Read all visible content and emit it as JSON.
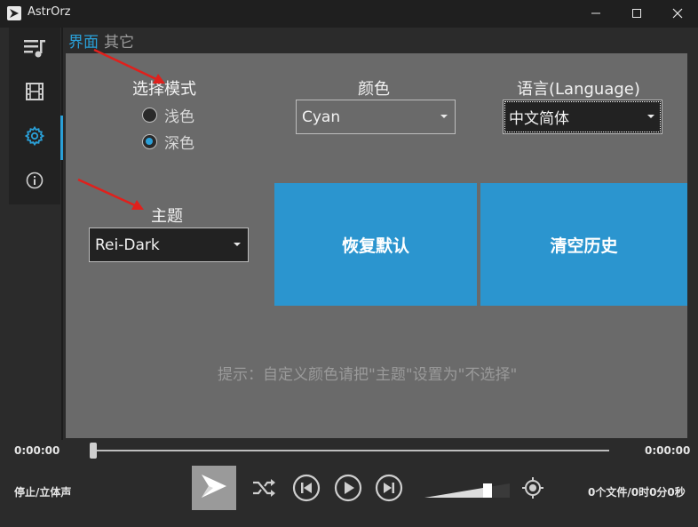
{
  "window": {
    "title": "AstrOrz",
    "minimize_icon": "minimize-icon",
    "maximize_icon": "maximize-icon",
    "close_icon": "close-icon"
  },
  "sidebar": {
    "items": [
      {
        "icon": "playlist-icon"
      },
      {
        "icon": "film-icon"
      },
      {
        "icon": "gear-icon",
        "active": true
      },
      {
        "icon": "info-icon"
      }
    ]
  },
  "tabs": [
    {
      "label": "界面",
      "active": true
    },
    {
      "label": "其它",
      "active": false
    }
  ],
  "settings": {
    "mode_label": "选择模式",
    "mode_options": [
      {
        "label": "浅色",
        "checked": false
      },
      {
        "label": "深色",
        "checked": true
      }
    ],
    "color_label": "颜色",
    "color_value": "Cyan",
    "language_label": "语言(Language)",
    "language_value": "中文简体",
    "theme_label": "主题",
    "theme_value": "Rei-Dark",
    "reset_button": "恢复默认",
    "clear_history_button": "清空历史",
    "hint": "提示：自定义颜色请把\"主题\"设置为\"不选择\""
  },
  "player": {
    "current_time": "0:00:00",
    "total_time": "0:00:00",
    "progress": 0,
    "status": "停止/立体声",
    "file_info": "0个文件/0时0分0秒",
    "volume": 0.75
  },
  "colors": {
    "accent": "#2aa0d8",
    "button": "#2b95cf",
    "panel": "#6a6a6a",
    "background": "#2b2b2b",
    "arrow": "#e0201c"
  }
}
